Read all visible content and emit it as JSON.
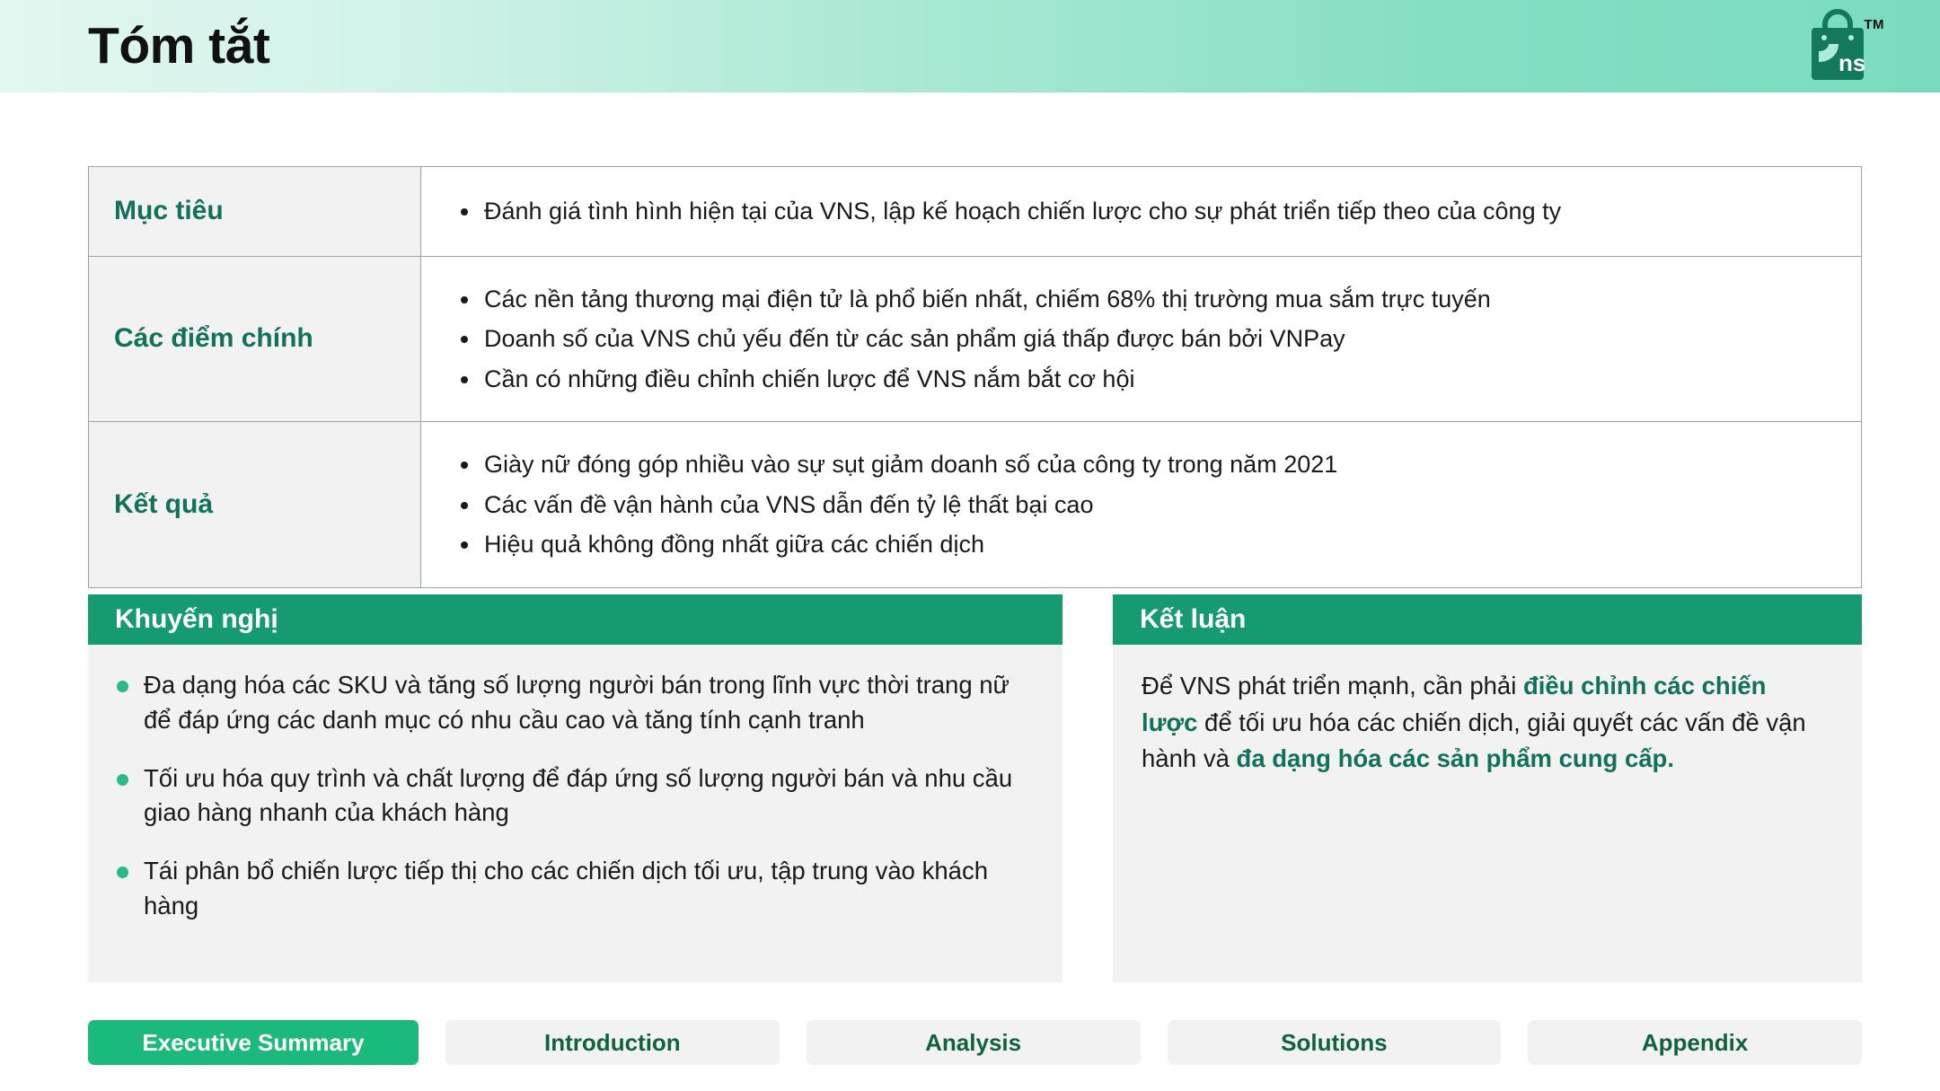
{
  "header": {
    "title": "Tóm tắt",
    "logo_name": "vns-shopping-bag-logo",
    "logo_text": "ns",
    "trademark": "TM",
    "gradient_from": "#e2f7f0",
    "gradient_to": "#7adbc0"
  },
  "colors": {
    "brand_green": "#169b70",
    "dark_green_text": "#11715a",
    "active_tab_green": "#1cb97d",
    "bullet_green": "#2bb98a",
    "panel_bg": "#f2f2f2",
    "table_border": "#9aa3a8"
  },
  "table": {
    "rows": [
      {
        "label": "Mục tiêu",
        "items": [
          "Đánh giá tình hình hiện tại của VNS, lập kế hoạch chiến lược cho sự phát triển tiếp theo của công ty"
        ]
      },
      {
        "label": "Các điểm chính",
        "items": [
          "Các nền tảng thương mại điện tử là phổ biến nhất, chiếm 68% thị trường mua sắm trực tuyến",
          "Doanh số của VNS chủ yếu đến từ các sản phẩm giá thấp được bán bởi VNPay",
          "Cần có những điều chỉnh chiến lược để VNS nắm bắt cơ hội"
        ]
      },
      {
        "label": "Kết quả",
        "items": [
          "Giày nữ đóng góp nhiều vào sự sụt giảm doanh số của công ty trong năm 2021",
          "Các vấn đề vận hành của VNS dẫn đến tỷ lệ thất bại cao",
          "Hiệu quả không đồng nhất giữa các chiến dịch"
        ]
      }
    ]
  },
  "recommendations": {
    "title": "Khuyến nghị",
    "items": [
      "Đa dạng hóa các SKU và tăng số lượng người bán trong lĩnh vực thời trang nữ để đáp ứng các danh mục có nhu cầu cao và tăng tính cạnh tranh",
      "Tối ưu hóa quy trình và chất lượng để đáp ứng số lượng người bán và nhu cầu giao hàng nhanh của khách hàng",
      "Tái phân bổ chiến lược tiếp thị cho các chiến dịch tối ưu, tập trung vào khách hàng"
    ]
  },
  "conclusion": {
    "title": "Kết luận",
    "segments": [
      {
        "text": "Để VNS phát triển mạnh, cần phải ",
        "bold": false
      },
      {
        "text": "điều chỉnh các chiến lược",
        "bold": true
      },
      {
        "text": " để tối ưu hóa các chiến dịch, giải quyết các vấn đề vận hành và ",
        "bold": false
      },
      {
        "text": "đa dạng hóa các sản phẩm cung cấp.",
        "bold": true
      }
    ],
    "plain_text": "Để VNS phát triển mạnh, cần phải điều chỉnh các chiến lược để tối ưu hóa các chiến dịch, giải quyết các vấn đề vận hành và đa dạng hóa các sản phẩm cung cấp."
  },
  "tabs": [
    {
      "label": "Executive Summary",
      "active": true
    },
    {
      "label": "Introduction",
      "active": false
    },
    {
      "label": "Analysis",
      "active": false
    },
    {
      "label": "Solutions",
      "active": false
    },
    {
      "label": "Appendix",
      "active": false
    }
  ]
}
